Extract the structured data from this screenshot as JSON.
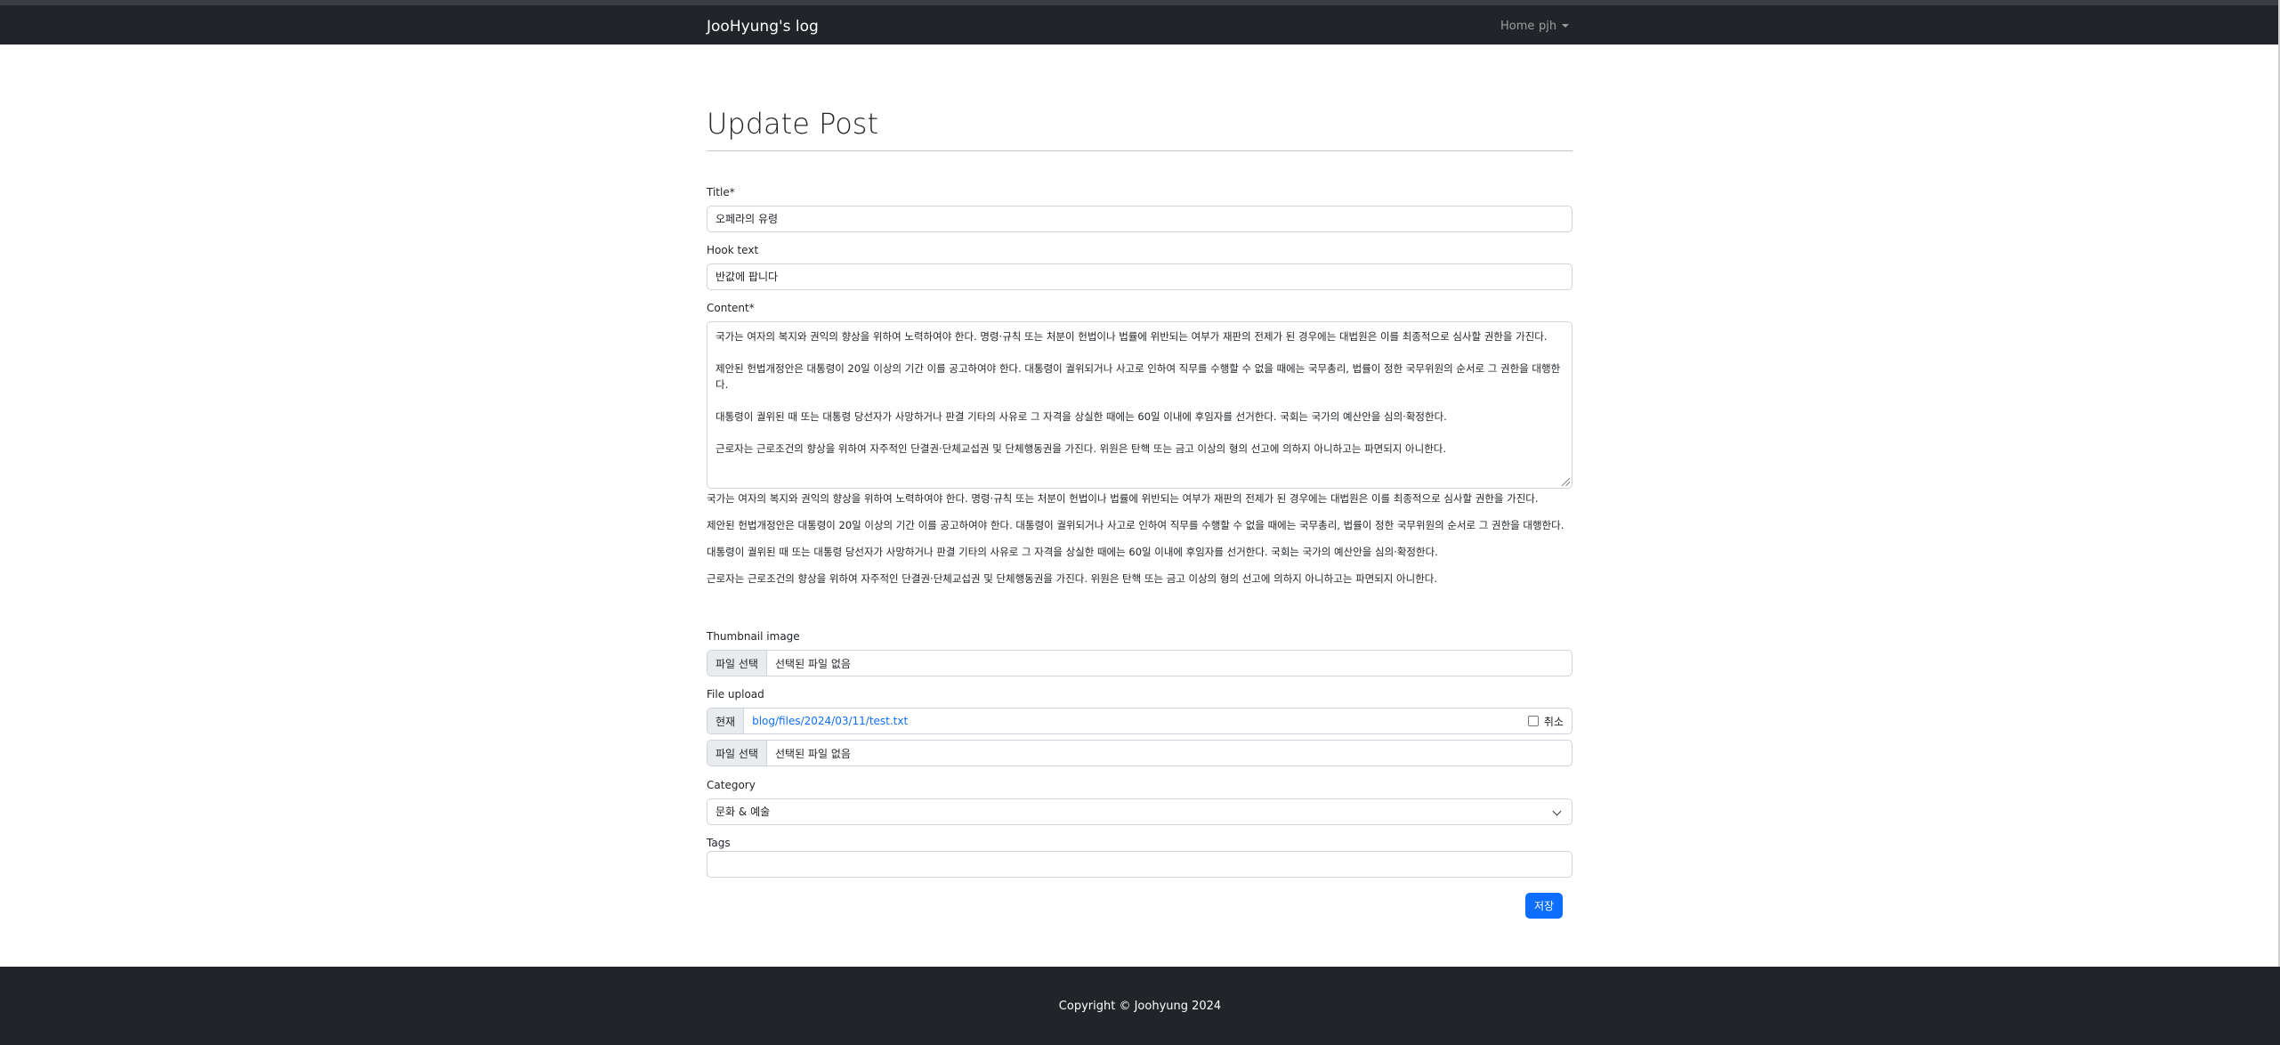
{
  "navbar": {
    "brand": "JooHyung's log",
    "home": "Home",
    "user": "pjh"
  },
  "page": {
    "title": "Update Post"
  },
  "form": {
    "title_label": "Title*",
    "title_value": "오페라의 유령",
    "hook_label": "Hook text",
    "hook_value": "반값에 팝니다",
    "content_label": "Content*",
    "content_paragraphs": [
      "국가는 여자의 복지와 권익의 향상을 위하여 노력하여야 한다. 명령·규칙 또는 처분이 헌법이나 법률에 위반되는 여부가 재판의 전제가 된 경우에는 대법원은 이를 최종적으로 심사할 권한을 가진다.",
      "제안된 헌법개정안은 대통령이 20일 이상의 기간 이를 공고하여야 한다. 대통령이 궐위되거나 사고로 인하여 직무를 수행할 수 없을 때에는 국무총리, 법률이 정한 국무위원의 순서로 그 권한을 대행한다.",
      "대통령이 궐위된 때 또는 대통령 당선자가 사망하거나 판결 기타의 사유로 그 자격을 상실한 때에는 60일 이내에 후임자를 선거한다. 국회는 국가의 예산안을 심의·확정한다.",
      "근로자는 근로조건의 향상을 위하여 자주적인 단결권·단체교섭권 및 단체행동권을 가진다. 위원은 탄핵 또는 금고 이상의 형의 선고에 의하지 아니하고는 파면되지 아니한다."
    ],
    "thumbnail_label": "Thumbnail image",
    "file_choose": "파일 선택",
    "no_file": "선택된 파일 없음",
    "upload_label": "File upload",
    "current_tag": "현재",
    "current_file": "blog/files/2024/03/11/test.txt",
    "clear_label": "취소",
    "category_label": "Category",
    "category_value": "문화 & 예술",
    "tags_label": "Tags",
    "tags_value": "",
    "save_label": "저장"
  },
  "footer": {
    "text": "Copyright © Joohyung 2024"
  }
}
